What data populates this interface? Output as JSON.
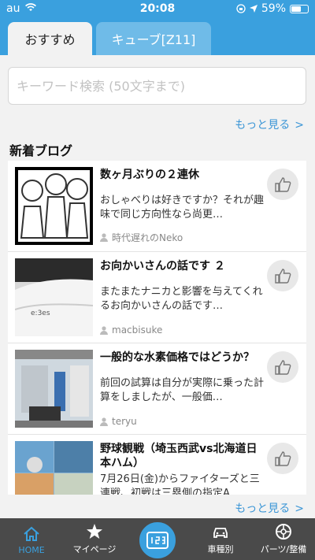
{
  "status_bar": {
    "carrier": "au",
    "time": "20:08",
    "battery": "59%",
    "battery_level": 0.59
  },
  "tabs": [
    {
      "label": "おすすめ",
      "active": true
    },
    {
      "label": "キューブ[Z11]",
      "active": false
    }
  ],
  "search": {
    "placeholder": "キーワード検索 (50文字まで)",
    "value": ""
  },
  "more_link": "もっと見る",
  "section_title": "新着ブログ",
  "posts": [
    {
      "title": "数ヶ月ぶりの２連休",
      "body": "おしゃべりは好きですか？それが趣味で同じ方向性なら尚更…",
      "author": "時代遅れのNeko"
    },
    {
      "title": "お向かいさんの話です ２",
      "body": "またまたナニカと影響を与えてくれるお向かいさんの話です…",
      "author": "macbisuke"
    },
    {
      "title": "一般的な水素価格ではどうか？",
      "body": "前回の試算は自分が実際に乗った計算をしましたが、一般価…",
      "author": "teryu"
    },
    {
      "title": "野球観戦（埼玉西武vs北海道日本ハム）",
      "body": "7月26日(金)からファイターズと三連戦、初戦は三塁側の指定A…",
      "author": ""
    }
  ],
  "bottom_nav": [
    {
      "label": "HOME",
      "icon": "home-icon",
      "active": true
    },
    {
      "label": "マイページ",
      "icon": "star-icon"
    },
    {
      "label": "",
      "icon": "center-logo-icon"
    },
    {
      "label": "車種別",
      "icon": "car-icon"
    },
    {
      "label": "パーツ/整備",
      "icon": "wheel-icon"
    }
  ],
  "colors": {
    "accent": "#3aa0de",
    "tabbar": "#4a4a4a",
    "link": "#3a95d6"
  }
}
